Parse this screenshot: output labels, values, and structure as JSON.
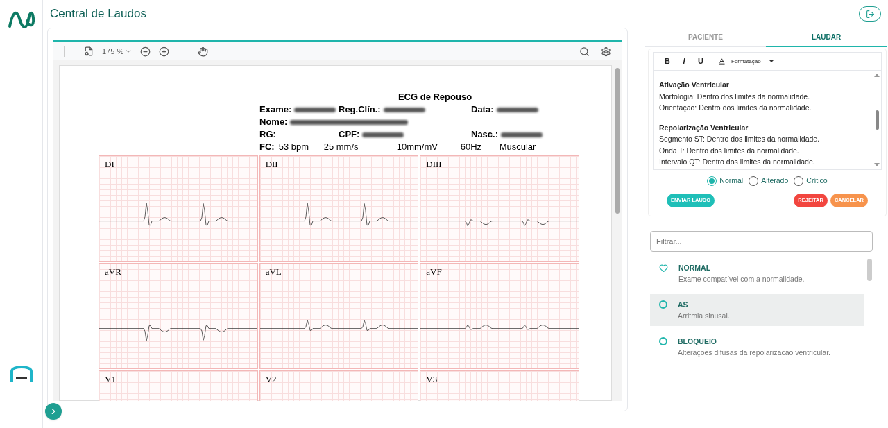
{
  "header": {
    "title": "Central de Laudos"
  },
  "viewer": {
    "zoom": "175 %"
  },
  "report": {
    "title": "ECG de Repouso",
    "rows": [
      [
        {
          "label": "Exame:",
          "redacted": true
        },
        {
          "label": "Reg.Clín.:",
          "redacted": true
        },
        {
          "label": "Data:",
          "redacted": true
        }
      ],
      [
        {
          "label": "Nome:",
          "redacted": true
        }
      ],
      [
        {
          "label": "RG:",
          "redacted": false
        },
        {
          "label": "CPF:",
          "redacted": true
        },
        {
          "label": "Nasc.:",
          "redacted": true
        }
      ]
    ],
    "fc": {
      "label": "FC:",
      "values": [
        "53 bpm",
        "25 mm/s",
        "10mm/mV",
        "60Hz",
        "Muscular"
      ]
    },
    "leads": [
      "DI",
      "DII",
      "DIII",
      "aVR",
      "aVL",
      "aVF",
      "V1",
      "V2",
      "V3"
    ]
  },
  "tabs": [
    {
      "label": "PACIENTE",
      "selected": false
    },
    {
      "label": "LAUDAR",
      "selected": true
    }
  ],
  "editor": {
    "toolbar": [
      "B",
      "I",
      "U"
    ],
    "format": "Formatação",
    "sections": [
      {
        "heading": "Ativação Ventricular",
        "lines": [
          "Morfologia: Dentro dos limites da normalidade.",
          "Orientação: Dentro dos limites da normalidade."
        ]
      },
      {
        "heading": "Repolarização Ventricular",
        "lines": [
          "Segmento ST: Dentro dos limites da normalidade.",
          "Onda T: Dentro dos limites da normalidade.",
          "Intervalo QT: Dentro dos limites da normalidade."
        ]
      }
    ]
  },
  "result": [
    {
      "label": "Normal",
      "selected": true
    },
    {
      "label": "Alterado",
      "selected": false
    },
    {
      "label": "Crítico",
      "selected": false
    }
  ],
  "actions": [
    {
      "label": "ENVIAR LAUDO",
      "kind": "primary"
    },
    {
      "label": "REJEITAR",
      "kind": "danger"
    },
    {
      "label": "CANCELAR",
      "kind": "warning"
    }
  ],
  "filter": {
    "placeholder": "Filtrar..."
  },
  "templates": [
    {
      "title": "NORMAL",
      "description": "Exame compatível com a normalidade.",
      "kind": "heart",
      "selected": false
    },
    {
      "title": "AS",
      "description": "Arritmia sinusal.",
      "kind": "circle",
      "selected": true
    },
    {
      "title": "BLOQUEIO",
      "description": "Alterações difusas da repolarizacao ventricular.",
      "kind": "circle",
      "selected": false
    }
  ]
}
